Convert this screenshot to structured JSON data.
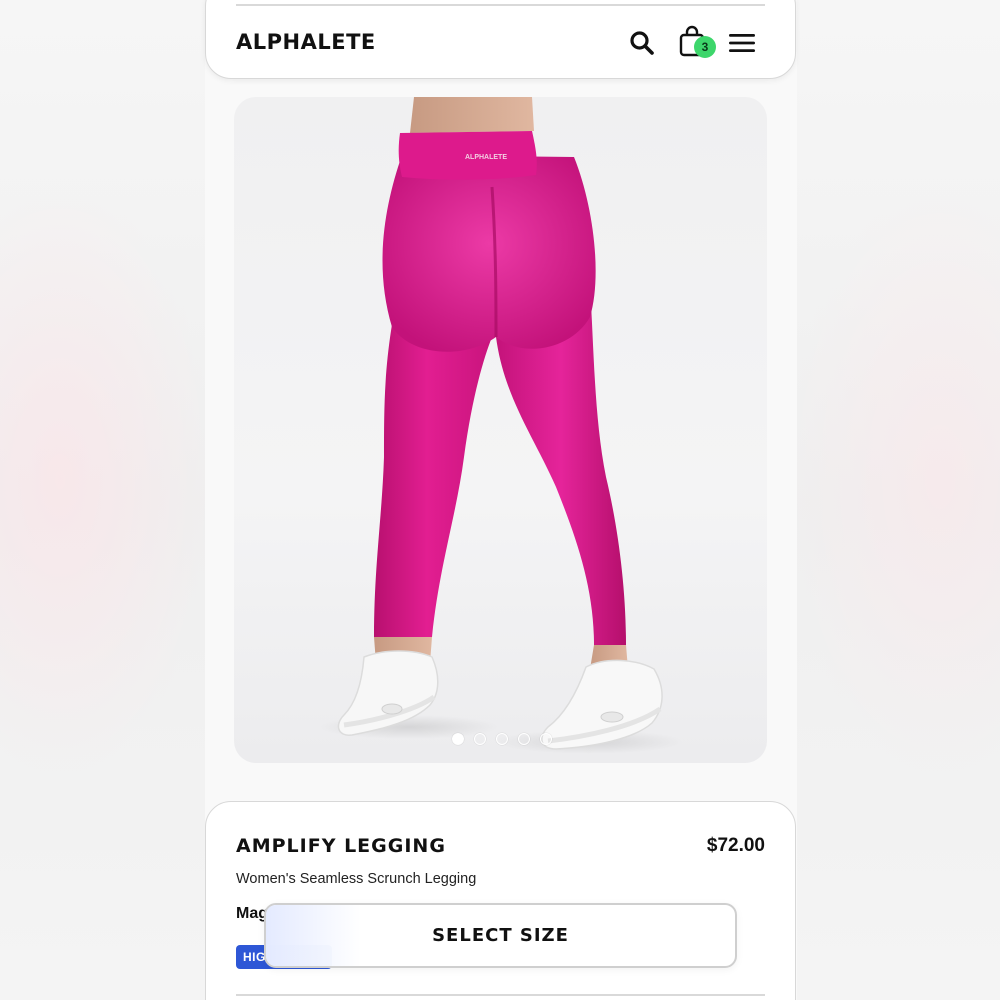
{
  "header": {
    "logo": "ALPHALETE",
    "cart_count": "3",
    "icons": [
      "search-icon",
      "shopping-bag-icon",
      "hamburger-menu-icon"
    ]
  },
  "gallery": {
    "image_count": 5,
    "active_index": 0,
    "waistband_text": "ALPHALETE"
  },
  "product": {
    "title": "AMPLIFY LEGGING",
    "price": "$72.00",
    "subtitle": "Women's Seamless Scrunch Legging",
    "color_name": "Mag",
    "tag": "HIG"
  },
  "cta": {
    "select_size_label": "SELECT SIZE"
  },
  "colors": {
    "accent_legging": "#e01c8f",
    "badge_green": "#3dd66b",
    "tag_blue": "#2e57d6"
  }
}
